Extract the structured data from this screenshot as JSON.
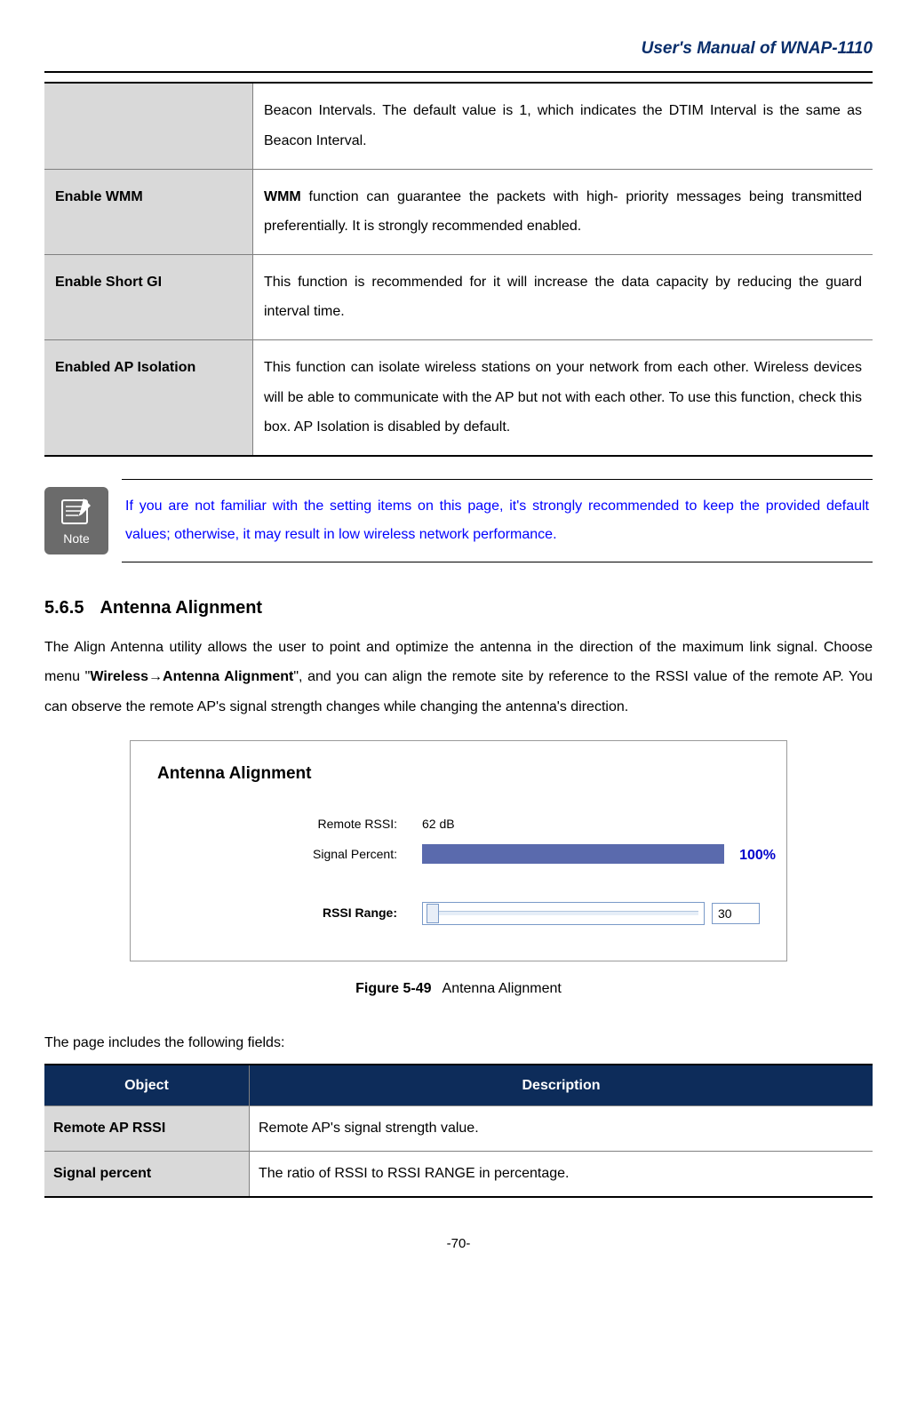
{
  "header": "User's Manual of WNAP-1110",
  "settings": [
    {
      "label": "",
      "desc_pre": "Beacon Intervals. The default value is 1, which indicates the DTIM Interval is the same as Beacon Interval."
    },
    {
      "label": "Enable WMM",
      "bold": "WMM",
      "desc": " function can guarantee the packets with high- priority messages being transmitted preferentially. It is strongly recommended enabled."
    },
    {
      "label": "Enable Short GI",
      "desc_pre": "This function is recommended for it will increase the data capacity by reducing the guard interval time."
    },
    {
      "label": "Enabled AP Isolation",
      "desc_pre": "This function can isolate wireless stations on your network from each other. Wireless devices will be able to communicate with the AP but not with each other. To use this function, check this box. AP Isolation is disabled by default."
    }
  ],
  "note_icon_label": "Note",
  "note_text": "If you are not familiar with the setting items on this page, it's strongly recommended to keep the provided default values; otherwise, it may result in low wireless network performance.",
  "section_num": "5.6.5",
  "section_title": "Antenna Alignment",
  "body_pre": "The Align Antenna utility allows the user to point and optimize the antenna in the direction of the maximum link signal. Choose menu \"",
  "body_bold1": "Wireless",
  "body_arrow": "→",
  "body_bold2": "Antenna Alignment",
  "body_post": "\", and you can align the remote site by reference to the RSSI value of the remote AP. You can observe the remote AP's signal strength changes while changing the antenna's direction.",
  "figure": {
    "title": "Antenna Alignment",
    "remote_rssi_label": "Remote RSSI:",
    "remote_rssi_value": "62 dB",
    "signal_percent_label": "Signal Percent:",
    "signal_percent_value": "100%",
    "rssi_range_label": "RSSI Range:",
    "rssi_range_value": "30"
  },
  "figure_caption_num": "Figure 5-49",
  "figure_caption_text": "Antenna Alignment",
  "fields_intro": "The page includes the following fields:",
  "fields_header": {
    "object": "Object",
    "description": "Description"
  },
  "fields": [
    {
      "label": "Remote AP RSSI",
      "desc": "Remote AP's signal strength value."
    },
    {
      "label": "Signal percent",
      "desc": "The ratio of RSSI to RSSI RANGE in percentage."
    }
  ],
  "page_number": "-70-"
}
